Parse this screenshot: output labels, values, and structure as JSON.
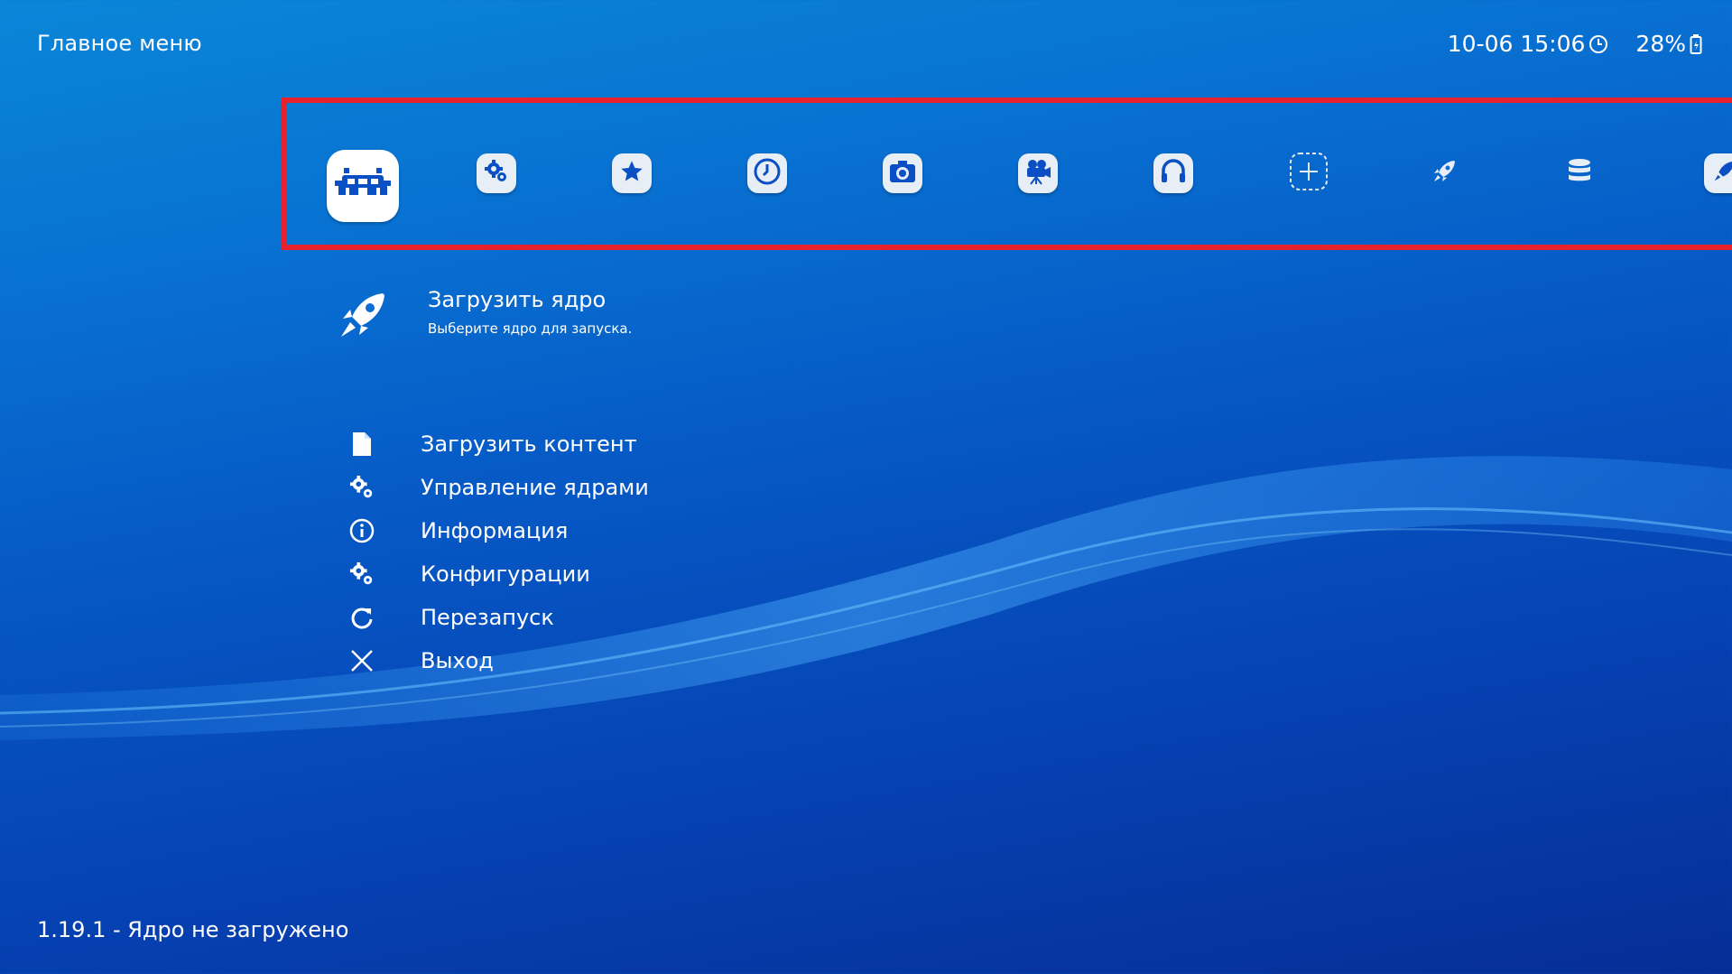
{
  "header": {
    "title": "Главное меню",
    "datetime": "10-06 15:06",
    "battery": "28%"
  },
  "tabs": [
    {
      "name": "main-menu",
      "icon": "retroarch-icon",
      "active": true
    },
    {
      "name": "settings",
      "icon": "settings-gears-icon"
    },
    {
      "name": "favorites",
      "icon": "star-icon"
    },
    {
      "name": "history",
      "icon": "clock-icon"
    },
    {
      "name": "images",
      "icon": "camera-icon"
    },
    {
      "name": "videos",
      "icon": "movie-camera-icon"
    },
    {
      "name": "music",
      "icon": "headphones-icon"
    },
    {
      "name": "import-content",
      "icon": "add-icon"
    },
    {
      "name": "core",
      "icon": "rocket-icon"
    },
    {
      "name": "database",
      "icon": "database-icon"
    },
    {
      "name": "core-2",
      "icon": "rocket-icon"
    }
  ],
  "selected": {
    "icon": "rocket-icon",
    "title": "Загрузить ядро",
    "subtitle": "Выберите ядро для запуска."
  },
  "menu": [
    {
      "label": "Загрузить контент",
      "icon": "file-icon"
    },
    {
      "label": "Управление ядрами",
      "icon": "gears-icon"
    },
    {
      "label": "Информация",
      "icon": "info-icon"
    },
    {
      "label": "Конфигурации",
      "icon": "gears-icon"
    },
    {
      "label": "Перезапуск",
      "icon": "restart-icon"
    },
    {
      "label": "Выход",
      "icon": "close-icon"
    }
  ],
  "footer": {
    "text": "1.19.1 - Ядро не загружено"
  },
  "colors": {
    "highlight_border": "#e8222d",
    "icon_fill": "#0a4fc4"
  }
}
